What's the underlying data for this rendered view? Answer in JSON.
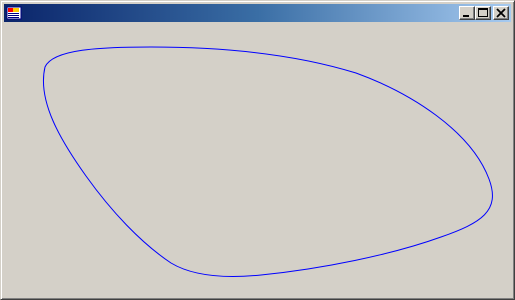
{
  "window": {
    "title": "",
    "app_icon": "app-window-icon",
    "buttons": {
      "minimize": "minimize-icon",
      "maximize": "maximize-icon",
      "close": "close-icon"
    }
  },
  "canvas": {
    "shape": "closed-curve",
    "stroke_color": "#0000ff",
    "background_color": "#d4d0c8"
  }
}
